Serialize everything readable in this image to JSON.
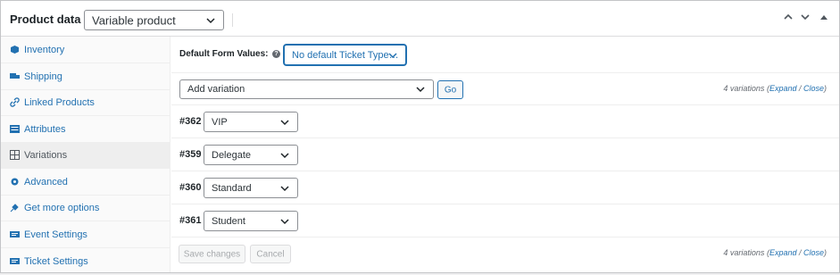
{
  "header": {
    "title": "Product data —",
    "product_type": "Variable product",
    "up_label": "Move up",
    "down_label": "Move down",
    "toggle_label": "Toggle panel"
  },
  "sidebar": {
    "items": [
      {
        "label": "Inventory",
        "icon": "inventory-icon"
      },
      {
        "label": "Shipping",
        "icon": "truck-icon"
      },
      {
        "label": "Linked Products",
        "icon": "link-icon"
      },
      {
        "label": "Attributes",
        "icon": "list-icon"
      },
      {
        "label": "Variations",
        "icon": "grid-icon"
      },
      {
        "label": "Advanced",
        "icon": "gear-icon"
      },
      {
        "label": "Get more options",
        "icon": "plugin-icon"
      },
      {
        "label": "Event Settings",
        "icon": "ticket-icon"
      },
      {
        "label": "Ticket Settings",
        "icon": "ticket-icon"
      }
    ],
    "active": "Variations"
  },
  "defaults": {
    "label": "Default Form Values:",
    "help": "?",
    "select": "No default Ticket Type…"
  },
  "toolbar": {
    "action_select": "Add variation",
    "go_label": "Go"
  },
  "count": {
    "text": "4 variations",
    "open": "(",
    "expand": "Expand",
    "sep": " / ",
    "close": "Close",
    "end": ")"
  },
  "variations": [
    {
      "id": "#362",
      "value": "VIP"
    },
    {
      "id": "#359",
      "value": "Delegate"
    },
    {
      "id": "#360",
      "value": "Standard"
    },
    {
      "id": "#361",
      "value": "Student"
    }
  ],
  "footer": {
    "save_label": "Save changes",
    "cancel_label": "Cancel"
  },
  "colors": {
    "accent": "#2271b1",
    "border": "#8c8f94",
    "sidebar_bg": "#fafafa",
    "active_bg": "#eeeeee"
  }
}
